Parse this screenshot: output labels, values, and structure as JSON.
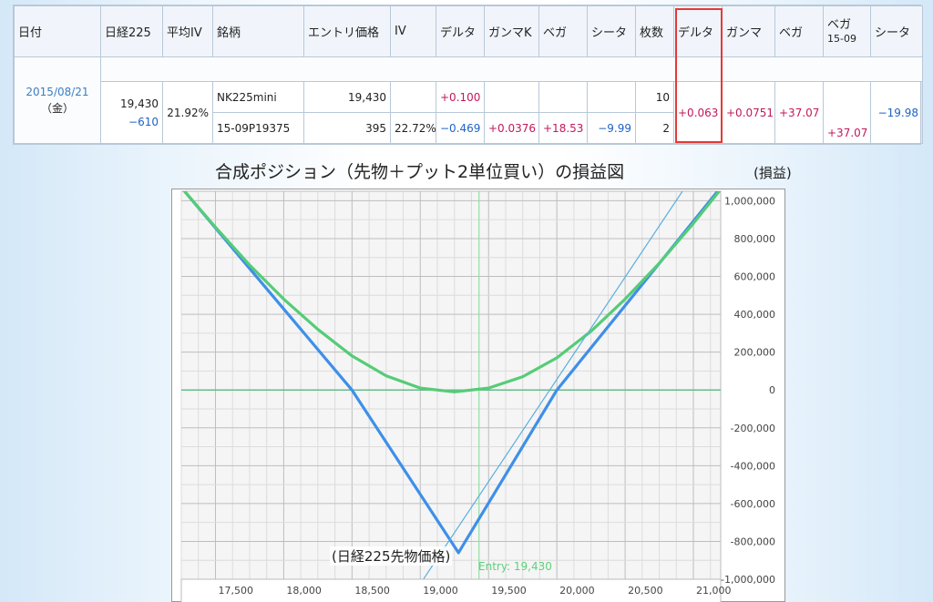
{
  "table": {
    "headers": [
      "日付",
      "日経225",
      "平均IV",
      "銘柄",
      "エントリ価格",
      "IV",
      "デルタ",
      "ガンマK",
      "ベガ",
      "シータ",
      "枚数",
      "デルタ",
      "ガンマ",
      "ベガ",
      "ベガ",
      "15-09",
      "シータ"
    ],
    "date": "2015/08/21",
    "day_of_week": "（金）",
    "nikkei": "19,430",
    "nikkei_change": "−610",
    "avg_iv": "21.92%",
    "rows": [
      {
        "name": "NK225mini",
        "entry": "19,430",
        "iv": "",
        "delta": "+0.100",
        "gamma_k": "",
        "vega": "",
        "theta": "",
        "qty": "10"
      },
      {
        "name": "15-09P19375",
        "entry": "395",
        "iv": "22.72%",
        "delta": "−0.469",
        "gamma_k": "+0.0376",
        "vega": "+18.53",
        "theta": "−9.99",
        "qty": "2"
      }
    ],
    "total": {
      "delta": "+0.063",
      "gamma": "+0.0751",
      "vega": "+37.07",
      "vega_1509": "+37.07",
      "theta": "−19.98"
    }
  },
  "colors": {
    "positive": "#c2185b",
    "negative": "#1e63c6",
    "highlight": "#e53935"
  },
  "chart_data": {
    "type": "line",
    "title": "合成ポジション（先物＋プット2単位買い）の損益図",
    "unit_label": "(損益)",
    "xlabel": "(日経225先物価格)",
    "entry_label": "Entry: 19,430",
    "entry_x": 19430,
    "xlim": [
      17250,
      21200
    ],
    "ylim": [
      -1000000,
      1050000
    ],
    "x_ticks": [
      17500,
      18000,
      18500,
      19000,
      19500,
      20000,
      20500,
      21000
    ],
    "x_tick_labels": [
      "17,500",
      "18,000",
      "18,500",
      "19,000",
      "19,500",
      "20,000",
      "20,500",
      "21,000"
    ],
    "y_ticks": [
      1000000,
      800000,
      600000,
      400000,
      200000,
      0,
      -200000,
      -400000,
      -600000,
      -800000,
      -1000000
    ],
    "y_tick_labels": [
      "1,000,000",
      "800,000",
      "600,000",
      "400,000",
      "200,000",
      "0",
      "-200,000",
      "-400,000",
      "-600,000",
      "-800,000",
      "-1,000,000"
    ],
    "series": [
      {
        "name": "",
        "kind": "expiry",
        "color": "#3f8fe8",
        "width": 3.2,
        "x": [
          17250,
          18500,
          19280,
          20000,
          21200
        ],
        "y": [
          1070000,
          0,
          -860000,
          0,
          1070000
        ]
      },
      {
        "name": "",
        "kind": "current",
        "color": "#55cc77",
        "width": 3.2,
        "x": [
          17250,
          17500,
          17750,
          18000,
          18250,
          18500,
          18750,
          19000,
          19250,
          19500,
          19750,
          20000,
          20250,
          20500,
          20750,
          21000,
          21200
        ],
        "y": [
          1070000,
          860000,
          660000,
          480000,
          320000,
          180000,
          75000,
          10000,
          -10000,
          10000,
          70000,
          170000,
          310000,
          480000,
          670000,
          880000,
          1060000
        ]
      },
      {
        "name": "",
        "kind": "futures",
        "color": "#5aaee0",
        "width": 1.2,
        "x": [
          18930,
          20920
        ],
        "y": [
          -1100000,
          1050000
        ]
      }
    ]
  }
}
